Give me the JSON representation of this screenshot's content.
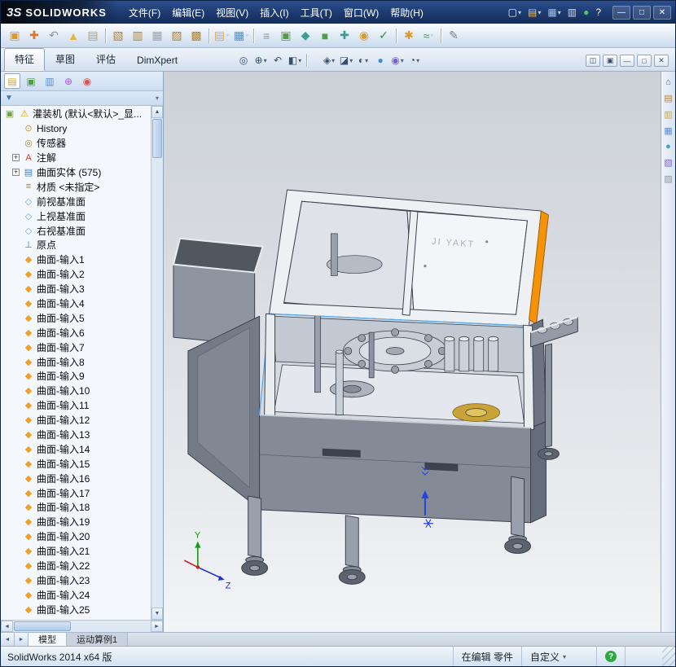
{
  "app": {
    "logo_mark": "3S",
    "logo_name": "SOLIDWORKS"
  },
  "titlebar": {
    "menus": [
      {
        "label": "文件(F)"
      },
      {
        "label": "编辑(E)"
      },
      {
        "label": "视图(V)"
      },
      {
        "label": "插入(I)"
      },
      {
        "label": "工具(T)"
      },
      {
        "label": "窗口(W)"
      },
      {
        "label": "帮助(H)"
      }
    ],
    "quick_icons": [
      {
        "name": "new-document-icon",
        "glyph": "▢",
        "color": "#f2f5f9",
        "caret": "▾"
      },
      {
        "name": "open-document-icon",
        "glyph": "▤",
        "color": "#f0c05a",
        "caret": "▾"
      },
      {
        "name": "save-document-icon",
        "glyph": "▦",
        "color": "#9fc2ea",
        "caret": "▾"
      },
      {
        "name": "print-document-icon",
        "glyph": "▥",
        "color": "#d8dde4"
      },
      {
        "name": "performance-indicator-icon",
        "glyph": "●",
        "color": "#3fd04f"
      },
      {
        "name": "help-icon",
        "glyph": "?",
        "color": "#ffffff"
      }
    ],
    "window_buttons": [
      {
        "name": "minimize-button",
        "glyph": "—"
      },
      {
        "name": "maximize-button",
        "glyph": "□"
      },
      {
        "name": "close-button",
        "glyph": "✕"
      }
    ]
  },
  "toolbar": {
    "icons": [
      {
        "name": "new-window-icon",
        "glyph": "▣",
        "color": "#d99a2b"
      },
      {
        "name": "select-move-icon",
        "glyph": "✚",
        "color": "#d9772b"
      },
      {
        "name": "undo-icon",
        "glyph": "↶",
        "color": "#8b95a2"
      },
      {
        "name": "alert-icon",
        "glyph": "▲",
        "color": "#e8b23a"
      },
      {
        "name": "copy-icon",
        "glyph": "▤",
        "color": "#d99a2b"
      },
      {
        "type": "sep"
      },
      {
        "name": "open-part-icon",
        "glyph": "▧",
        "color": "#b5822a"
      },
      {
        "name": "save-table-icon",
        "glyph": "▥",
        "color": "#b5822a"
      },
      {
        "name": "print-icon",
        "glyph": "▦",
        "color": "#9aa2ae"
      },
      {
        "name": "file-properties-icon",
        "glyph": "▨",
        "color": "#b5822a"
      },
      {
        "name": "pack-and-go-icon",
        "glyph": "▩",
        "color": "#b5822a"
      },
      {
        "type": "sep"
      },
      {
        "name": "make-drawing-icon",
        "glyph": "▤",
        "color": "#e8a33d",
        "caret": "▾"
      },
      {
        "name": "component-pattern-icon",
        "glyph": "▦",
        "color": "#5a8fd4",
        "caret": "▾"
      },
      {
        "type": "sep"
      },
      {
        "name": "align-icon",
        "glyph": "≡",
        "color": "#8b95a2"
      },
      {
        "name": "instant3d-icon",
        "glyph": "▣",
        "color": "#4f9e45"
      },
      {
        "name": "surface-tool-icon",
        "glyph": "◆",
        "color": "#3e9e8e"
      },
      {
        "name": "extrude-icon",
        "glyph": "■",
        "color": "#4f9e45"
      },
      {
        "name": "measure-icon",
        "glyph": "✚",
        "color": "#3e9e8e"
      },
      {
        "name": "mass-properties-icon",
        "glyph": "◉",
        "color": "#d99a2b"
      },
      {
        "name": "check-icon",
        "glyph": "✓",
        "color": "#2f8f3f"
      },
      {
        "type": "sep"
      },
      {
        "name": "curvature-icon",
        "glyph": "✱",
        "color": "#d99a2b"
      },
      {
        "name": "spline-icon",
        "glyph": "≈",
        "color": "#3f9e3f",
        "caret": "▾"
      },
      {
        "type": "sep"
      },
      {
        "name": "sketch-pencil-icon",
        "glyph": "✎",
        "color": "#7a828e"
      }
    ]
  },
  "command_bar": {
    "tabs": [
      {
        "label": "特征",
        "active": "true"
      },
      {
        "label": "草图"
      },
      {
        "label": "评估"
      },
      {
        "label": "DimXpert"
      }
    ],
    "headsup_icons": [
      {
        "name": "zoom-fit-icon",
        "glyph": "◎",
        "color": "#35506b"
      },
      {
        "name": "zoom-area-icon",
        "glyph": "⊕",
        "color": "#35506b",
        "caret": "▾"
      },
      {
        "name": "previous-view-icon",
        "glyph": "↶",
        "color": "#35506b"
      },
      {
        "name": "section-view-icon",
        "glyph": "◧",
        "color": "#35506b",
        "caret": "▾"
      },
      {
        "type": "sep"
      },
      {
        "name": "view-orientation-icon",
        "glyph": "◈",
        "color": "#35506b",
        "caret": "▾"
      },
      {
        "name": "display-style-icon",
        "glyph": "◪",
        "color": "#35506b",
        "caret": "▾"
      },
      {
        "name": "hide-show-items-icon",
        "glyph": "◐",
        "color": "#35506b",
        "caret": "▾"
      },
      {
        "name": "edit-appearance-icon",
        "glyph": "●",
        "color": "#3f8fd4"
      },
      {
        "name": "apply-scene-icon",
        "glyph": "◉",
        "color": "#7a5fd4",
        "caret": "▾"
      },
      {
        "name": "view-settings-icon",
        "glyph": "◔",
        "color": "#35506b",
        "caret": "▾"
      }
    ],
    "doc_window_buttons": [
      {
        "name": "pane-split-icon",
        "glyph": "◫"
      },
      {
        "name": "pane-grid-icon",
        "glyph": "▣"
      },
      {
        "name": "doc-minimize-icon",
        "glyph": "—"
      },
      {
        "name": "doc-restore-icon",
        "glyph": "□"
      },
      {
        "name": "doc-close-icon",
        "glyph": "✕"
      }
    ]
  },
  "feature_panel": {
    "tab_icons": [
      {
        "name": "featuremanager-tab-icon",
        "glyph": "▤",
        "color": "#caa53d",
        "active": "true"
      },
      {
        "name": "propertymanager-tab-icon",
        "glyph": "▣",
        "color": "#4f9e45"
      },
      {
        "name": "configurationmanager-tab-icon",
        "glyph": "▥",
        "color": "#5a8fd4"
      },
      {
        "name": "dimxpertmanager-tab-icon",
        "glyph": "⊕",
        "color": "#a85ad4"
      },
      {
        "name": "displaymanager-tab-icon",
        "glyph": "◉",
        "color": "#d94f4f"
      }
    ],
    "overflow_chevron": "»",
    "funnel_glyph": "▼",
    "filter_caret": "▾",
    "root": {
      "label": "灌装机 (默认<默认>_显..."
    },
    "root_icons": [
      {
        "name": "part-icon",
        "glyph": "▣",
        "color": "#7a9e3f"
      },
      {
        "name": "warning-icon",
        "glyph": "⚠",
        "color": "#e0a400"
      }
    ],
    "items": [
      {
        "name": "history-folder",
        "expander": "",
        "glyph": "⊙",
        "color": "#c9932f",
        "label": "History"
      },
      {
        "name": "sensors-folder",
        "expander": "",
        "glyph": "◎",
        "color": "#b08830",
        "label": "传感器"
      },
      {
        "name": "annotations-folder",
        "expander": "+",
        "glyph": "A",
        "color": "#cc4433",
        "label": "注解"
      },
      {
        "name": "surface-bodies-folder",
        "expander": "+",
        "glyph": "▤",
        "color": "#3f7fc4",
        "label": "曲面实体 (575)"
      },
      {
        "name": "material",
        "expander": "",
        "glyph": "≡",
        "color": "#8a7f63",
        "label": "材质 <未指定>"
      },
      {
        "name": "front-plane",
        "expander": "",
        "glyph": "◇",
        "color": "#6fa8dc",
        "label": "前视基准面"
      },
      {
        "name": "top-plane",
        "expander": "",
        "glyph": "◇",
        "color": "#6fa8dc",
        "label": "上视基准面"
      },
      {
        "name": "right-plane",
        "expander": "",
        "glyph": "◇",
        "color": "#6fa8dc",
        "label": "右视基准面"
      },
      {
        "name": "origin",
        "expander": "",
        "glyph": "⊥",
        "color": "#3c6fb0",
        "label": "原点"
      },
      {
        "name": "surface-import",
        "expander": "",
        "glyph": "◆",
        "color": "#f0a028",
        "label": "曲面-输入1"
      },
      {
        "name": "surface-import",
        "expander": "",
        "glyph": "◆",
        "color": "#f0a028",
        "label": "曲面-输入2"
      },
      {
        "name": "surface-import",
        "expander": "",
        "glyph": "◆",
        "color": "#f0a028",
        "label": "曲面-输入3"
      },
      {
        "name": "surface-import",
        "expander": "",
        "glyph": "◆",
        "color": "#f0a028",
        "label": "曲面-输入4"
      },
      {
        "name": "surface-import",
        "expander": "",
        "glyph": "◆",
        "color": "#f0a028",
        "label": "曲面-输入5"
      },
      {
        "name": "surface-import",
        "expander": "",
        "glyph": "◆",
        "color": "#f0a028",
        "label": "曲面-输入6"
      },
      {
        "name": "surface-import",
        "expander": "",
        "glyph": "◆",
        "color": "#f0a028",
        "label": "曲面-输入7"
      },
      {
        "name": "surface-import",
        "expander": "",
        "glyph": "◆",
        "color": "#f0a028",
        "label": "曲面-输入8"
      },
      {
        "name": "surface-import",
        "expander": "",
        "glyph": "◆",
        "color": "#f0a028",
        "label": "曲面-输入9"
      },
      {
        "name": "surface-import",
        "expander": "",
        "glyph": "◆",
        "color": "#f0a028",
        "label": "曲面-输入10"
      },
      {
        "name": "surface-import",
        "expander": "",
        "glyph": "◆",
        "color": "#f0a028",
        "label": "曲面-输入11"
      },
      {
        "name": "surface-import",
        "expander": "",
        "glyph": "◆",
        "color": "#f0a028",
        "label": "曲面-输入12"
      },
      {
        "name": "surface-import",
        "expander": "",
        "glyph": "◆",
        "color": "#f0a028",
        "label": "曲面-输入13"
      },
      {
        "name": "surface-import",
        "expander": "",
        "glyph": "◆",
        "color": "#f0a028",
        "label": "曲面-输入14"
      },
      {
        "name": "surface-import",
        "expander": "",
        "glyph": "◆",
        "color": "#f0a028",
        "label": "曲面-输入15"
      },
      {
        "name": "surface-import",
        "expander": "",
        "glyph": "◆",
        "color": "#f0a028",
        "label": "曲面-输入16"
      },
      {
        "name": "surface-import",
        "expander": "",
        "glyph": "◆",
        "color": "#f0a028",
        "label": "曲面-输入17"
      },
      {
        "name": "surface-import",
        "expander": "",
        "glyph": "◆",
        "color": "#f0a028",
        "label": "曲面-输入18"
      },
      {
        "name": "surface-import",
        "expander": "",
        "glyph": "◆",
        "color": "#f0a028",
        "label": "曲面-输入19"
      },
      {
        "name": "surface-import",
        "expander": "",
        "glyph": "◆",
        "color": "#f0a028",
        "label": "曲面-输入20"
      },
      {
        "name": "surface-import",
        "expander": "",
        "glyph": "◆",
        "color": "#f0a028",
        "label": "曲面-输入21"
      },
      {
        "name": "surface-import",
        "expander": "",
        "glyph": "◆",
        "color": "#f0a028",
        "label": "曲面-输入22"
      },
      {
        "name": "surface-import",
        "expander": "",
        "glyph": "◆",
        "color": "#f0a028",
        "label": "曲面-输入23"
      },
      {
        "name": "surface-import",
        "expander": "",
        "glyph": "◆",
        "color": "#f0a028",
        "label": "曲面-输入24"
      },
      {
        "name": "surface-import",
        "expander": "",
        "glyph": "◆",
        "color": "#f0a028",
        "label": "曲面-输入25"
      }
    ],
    "scroll": {
      "up": "▲",
      "down": "▼",
      "left": "◄",
      "right": "►"
    }
  },
  "viewport": {
    "panel_label": "JI YAKT",
    "accent_orange": "#f5920a",
    "highlight_blue": "#58a8f0",
    "triad": {
      "y": "Y",
      "z": "Z"
    }
  },
  "taskpane": {
    "icons": [
      {
        "name": "resources-home-icon",
        "glyph": "⌂",
        "color": "#4a6fa5"
      },
      {
        "name": "design-library-icon",
        "glyph": "▤",
        "color": "#b5822a"
      },
      {
        "name": "file-explorer-icon",
        "glyph": "▥",
        "color": "#caa53d"
      },
      {
        "name": "view-palette-icon",
        "glyph": "▦",
        "color": "#5a8fd4"
      },
      {
        "name": "appearances-icon",
        "glyph": "●",
        "color": "#3fa0d0"
      },
      {
        "name": "scenes-icon",
        "glyph": "▧",
        "color": "#7a5fd4"
      },
      {
        "name": "custom-properties-icon",
        "glyph": "▨",
        "color": "#8b95a2"
      }
    ]
  },
  "bottom_bar": {
    "nav": [
      {
        "name": "tab-scroll-left",
        "glyph": "◄"
      },
      {
        "name": "tab-scroll-right",
        "glyph": "►"
      }
    ],
    "tabs": [
      {
        "label": "模型",
        "active": "true"
      },
      {
        "label": "运动算例1"
      }
    ]
  },
  "statusbar": {
    "app_version": "SolidWorks 2014 x64 版",
    "edit_state": "在编辑 零件",
    "custom": "自定义",
    "custom_caret": "▾",
    "help_glyph": "?"
  }
}
